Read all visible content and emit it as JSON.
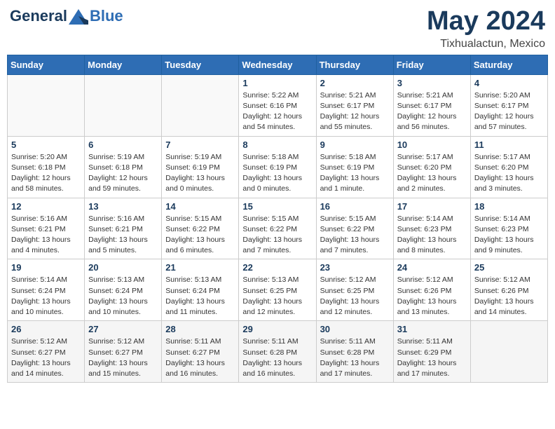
{
  "header": {
    "logo_line1": "General",
    "logo_line2": "Blue",
    "month": "May 2024",
    "location": "Tixhualactun, Mexico"
  },
  "weekdays": [
    "Sunday",
    "Monday",
    "Tuesday",
    "Wednesday",
    "Thursday",
    "Friday",
    "Saturday"
  ],
  "weeks": [
    [
      {
        "day": "",
        "detail": ""
      },
      {
        "day": "",
        "detail": ""
      },
      {
        "day": "",
        "detail": ""
      },
      {
        "day": "1",
        "detail": "Sunrise: 5:22 AM\nSunset: 6:16 PM\nDaylight: 12 hours\nand 54 minutes."
      },
      {
        "day": "2",
        "detail": "Sunrise: 5:21 AM\nSunset: 6:17 PM\nDaylight: 12 hours\nand 55 minutes."
      },
      {
        "day": "3",
        "detail": "Sunrise: 5:21 AM\nSunset: 6:17 PM\nDaylight: 12 hours\nand 56 minutes."
      },
      {
        "day": "4",
        "detail": "Sunrise: 5:20 AM\nSunset: 6:17 PM\nDaylight: 12 hours\nand 57 minutes."
      }
    ],
    [
      {
        "day": "5",
        "detail": "Sunrise: 5:20 AM\nSunset: 6:18 PM\nDaylight: 12 hours\nand 58 minutes."
      },
      {
        "day": "6",
        "detail": "Sunrise: 5:19 AM\nSunset: 6:18 PM\nDaylight: 12 hours\nand 59 minutes."
      },
      {
        "day": "7",
        "detail": "Sunrise: 5:19 AM\nSunset: 6:19 PM\nDaylight: 13 hours\nand 0 minutes."
      },
      {
        "day": "8",
        "detail": "Sunrise: 5:18 AM\nSunset: 6:19 PM\nDaylight: 13 hours\nand 0 minutes."
      },
      {
        "day": "9",
        "detail": "Sunrise: 5:18 AM\nSunset: 6:19 PM\nDaylight: 13 hours\nand 1 minute."
      },
      {
        "day": "10",
        "detail": "Sunrise: 5:17 AM\nSunset: 6:20 PM\nDaylight: 13 hours\nand 2 minutes."
      },
      {
        "day": "11",
        "detail": "Sunrise: 5:17 AM\nSunset: 6:20 PM\nDaylight: 13 hours\nand 3 minutes."
      }
    ],
    [
      {
        "day": "12",
        "detail": "Sunrise: 5:16 AM\nSunset: 6:21 PM\nDaylight: 13 hours\nand 4 minutes."
      },
      {
        "day": "13",
        "detail": "Sunrise: 5:16 AM\nSunset: 6:21 PM\nDaylight: 13 hours\nand 5 minutes."
      },
      {
        "day": "14",
        "detail": "Sunrise: 5:15 AM\nSunset: 6:22 PM\nDaylight: 13 hours\nand 6 minutes."
      },
      {
        "day": "15",
        "detail": "Sunrise: 5:15 AM\nSunset: 6:22 PM\nDaylight: 13 hours\nand 7 minutes."
      },
      {
        "day": "16",
        "detail": "Sunrise: 5:15 AM\nSunset: 6:22 PM\nDaylight: 13 hours\nand 7 minutes."
      },
      {
        "day": "17",
        "detail": "Sunrise: 5:14 AM\nSunset: 6:23 PM\nDaylight: 13 hours\nand 8 minutes."
      },
      {
        "day": "18",
        "detail": "Sunrise: 5:14 AM\nSunset: 6:23 PM\nDaylight: 13 hours\nand 9 minutes."
      }
    ],
    [
      {
        "day": "19",
        "detail": "Sunrise: 5:14 AM\nSunset: 6:24 PM\nDaylight: 13 hours\nand 10 minutes."
      },
      {
        "day": "20",
        "detail": "Sunrise: 5:13 AM\nSunset: 6:24 PM\nDaylight: 13 hours\nand 10 minutes."
      },
      {
        "day": "21",
        "detail": "Sunrise: 5:13 AM\nSunset: 6:24 PM\nDaylight: 13 hours\nand 11 minutes."
      },
      {
        "day": "22",
        "detail": "Sunrise: 5:13 AM\nSunset: 6:25 PM\nDaylight: 13 hours\nand 12 minutes."
      },
      {
        "day": "23",
        "detail": "Sunrise: 5:12 AM\nSunset: 6:25 PM\nDaylight: 13 hours\nand 12 minutes."
      },
      {
        "day": "24",
        "detail": "Sunrise: 5:12 AM\nSunset: 6:26 PM\nDaylight: 13 hours\nand 13 minutes."
      },
      {
        "day": "25",
        "detail": "Sunrise: 5:12 AM\nSunset: 6:26 PM\nDaylight: 13 hours\nand 14 minutes."
      }
    ],
    [
      {
        "day": "26",
        "detail": "Sunrise: 5:12 AM\nSunset: 6:27 PM\nDaylight: 13 hours\nand 14 minutes."
      },
      {
        "day": "27",
        "detail": "Sunrise: 5:12 AM\nSunset: 6:27 PM\nDaylight: 13 hours\nand 15 minutes."
      },
      {
        "day": "28",
        "detail": "Sunrise: 5:11 AM\nSunset: 6:27 PM\nDaylight: 13 hours\nand 16 minutes."
      },
      {
        "day": "29",
        "detail": "Sunrise: 5:11 AM\nSunset: 6:28 PM\nDaylight: 13 hours\nand 16 minutes."
      },
      {
        "day": "30",
        "detail": "Sunrise: 5:11 AM\nSunset: 6:28 PM\nDaylight: 13 hours\nand 17 minutes."
      },
      {
        "day": "31",
        "detail": "Sunrise: 5:11 AM\nSunset: 6:29 PM\nDaylight: 13 hours\nand 17 minutes."
      },
      {
        "day": "",
        "detail": ""
      }
    ]
  ]
}
